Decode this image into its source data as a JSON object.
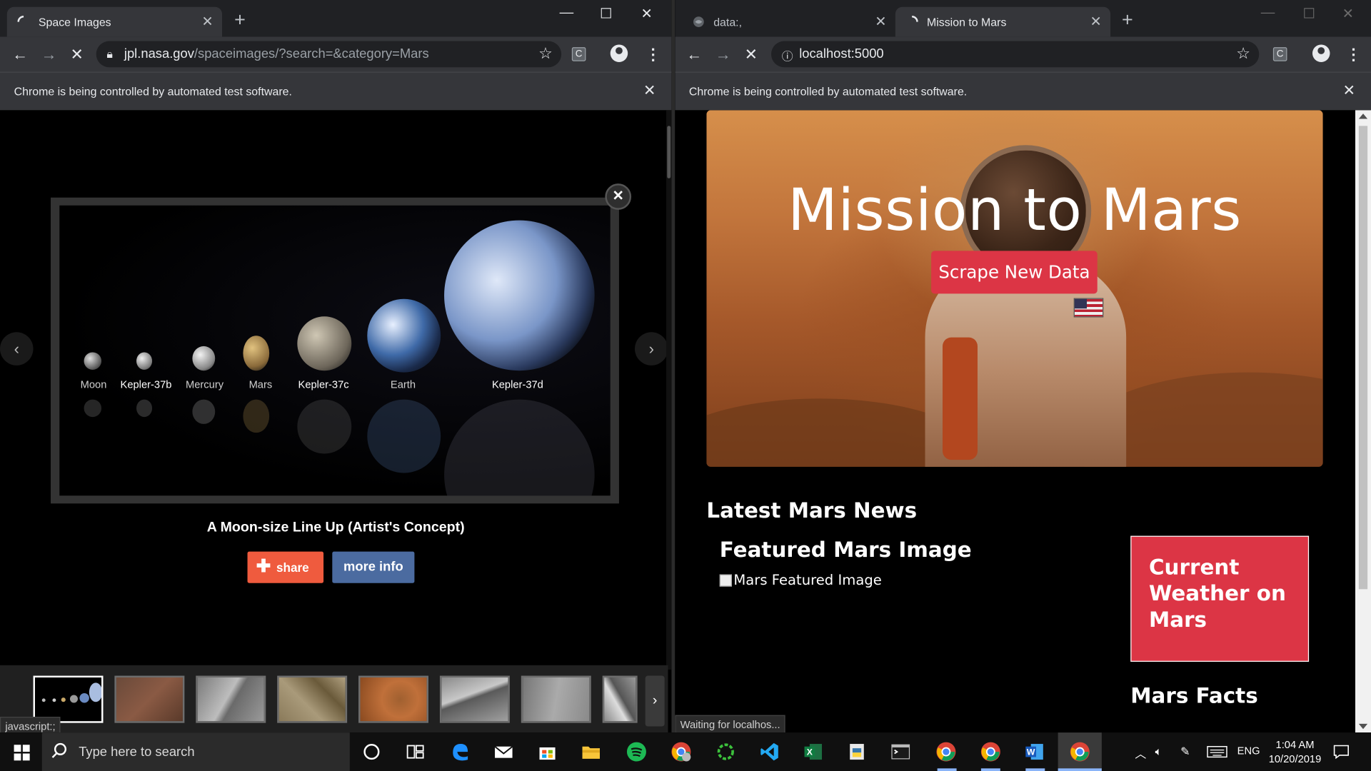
{
  "left_window": {
    "tab_title": "Space Images",
    "url_host": "jpl.nasa.gov",
    "url_path": "/spaceimages/?search=&category=Mars",
    "ext_label": "C",
    "infobar_text": "Chrome is being controlled by automated test software.",
    "lightbox": {
      "planets": [
        "Moon",
        "Kepler-37b",
        "Mercury",
        "Mars",
        "Kepler-37c",
        "Earth",
        "Kepler-37d"
      ],
      "caption": "A Moon-size Line Up (Artist's Concept)",
      "share_label": "share",
      "more_info_label": "more info"
    },
    "status_text": "javascript:;"
  },
  "right_window": {
    "tabs": [
      {
        "title": "data:,"
      },
      {
        "title": "Mission to Mars"
      }
    ],
    "url": "localhost:5000",
    "ext_label": "C",
    "infobar_text": "Chrome is being controlled by automated test software.",
    "page": {
      "title": "Mission to Mars",
      "scrape_button": "Scrape New Data",
      "news_heading": "Latest Mars News",
      "featured_heading": "Featured Mars Image",
      "featured_alt": "Mars Featured Image",
      "weather_heading": "Current Weather on Mars",
      "facts_heading": "Mars Facts"
    },
    "status_text": "Waiting for localhos..."
  },
  "taskbar": {
    "search_placeholder": "Type here to search",
    "language": "ENG",
    "time": "1:04 AM",
    "date": "10/20/2019",
    "apps": [
      "cortana-icon",
      "task-view-icon",
      "edge-icon",
      "mail-icon",
      "store-icon",
      "file-explorer-icon",
      "spotify-icon",
      "chrome-profile-icon",
      "ring-app-icon",
      "vscode-icon",
      "excel-icon",
      "python-icon",
      "terminal-icon",
      "chrome-icon",
      "chrome-icon",
      "word-icon",
      "chrome-active-icon"
    ]
  }
}
